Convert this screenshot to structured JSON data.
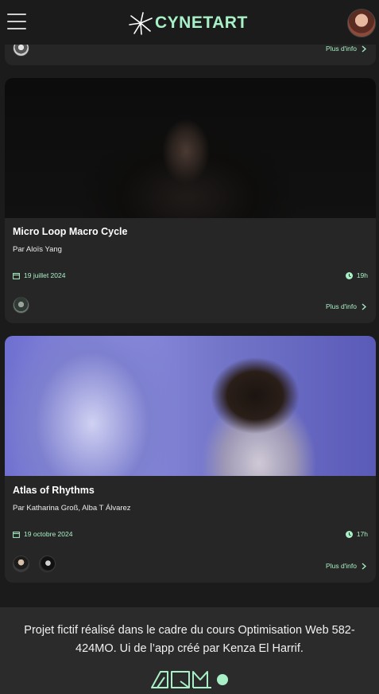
{
  "header": {
    "brand": "CYNETART",
    "menu_icon": "hamburger-menu-icon",
    "logo_icon": "starburst-logo-icon"
  },
  "cards": [
    {
      "more_label": "Plus d'info"
    },
    {
      "title": "Micro Loop Macro Cycle",
      "artists": "Par Aloïs Yang",
      "date": "19 juillet 2024",
      "time": "19h",
      "more_label": "Plus d'info"
    },
    {
      "title": "Atlas of Rhythms",
      "artists": "Par Katharina Groß, Alba T Álvarez",
      "date": "19 octobre 2024",
      "time": "17h",
      "more_label": "Plus d'info"
    }
  ],
  "footer": {
    "text": "Projet fictif réalisé dans le cadre du cours Optimisation Web 582-424MO. Ui de l’app créé par Kenza El Harrif."
  },
  "colors": {
    "accent": "#a8f0c6",
    "background": "#1b1b1b",
    "card": "#262626",
    "footer": "#2b2b2b"
  }
}
